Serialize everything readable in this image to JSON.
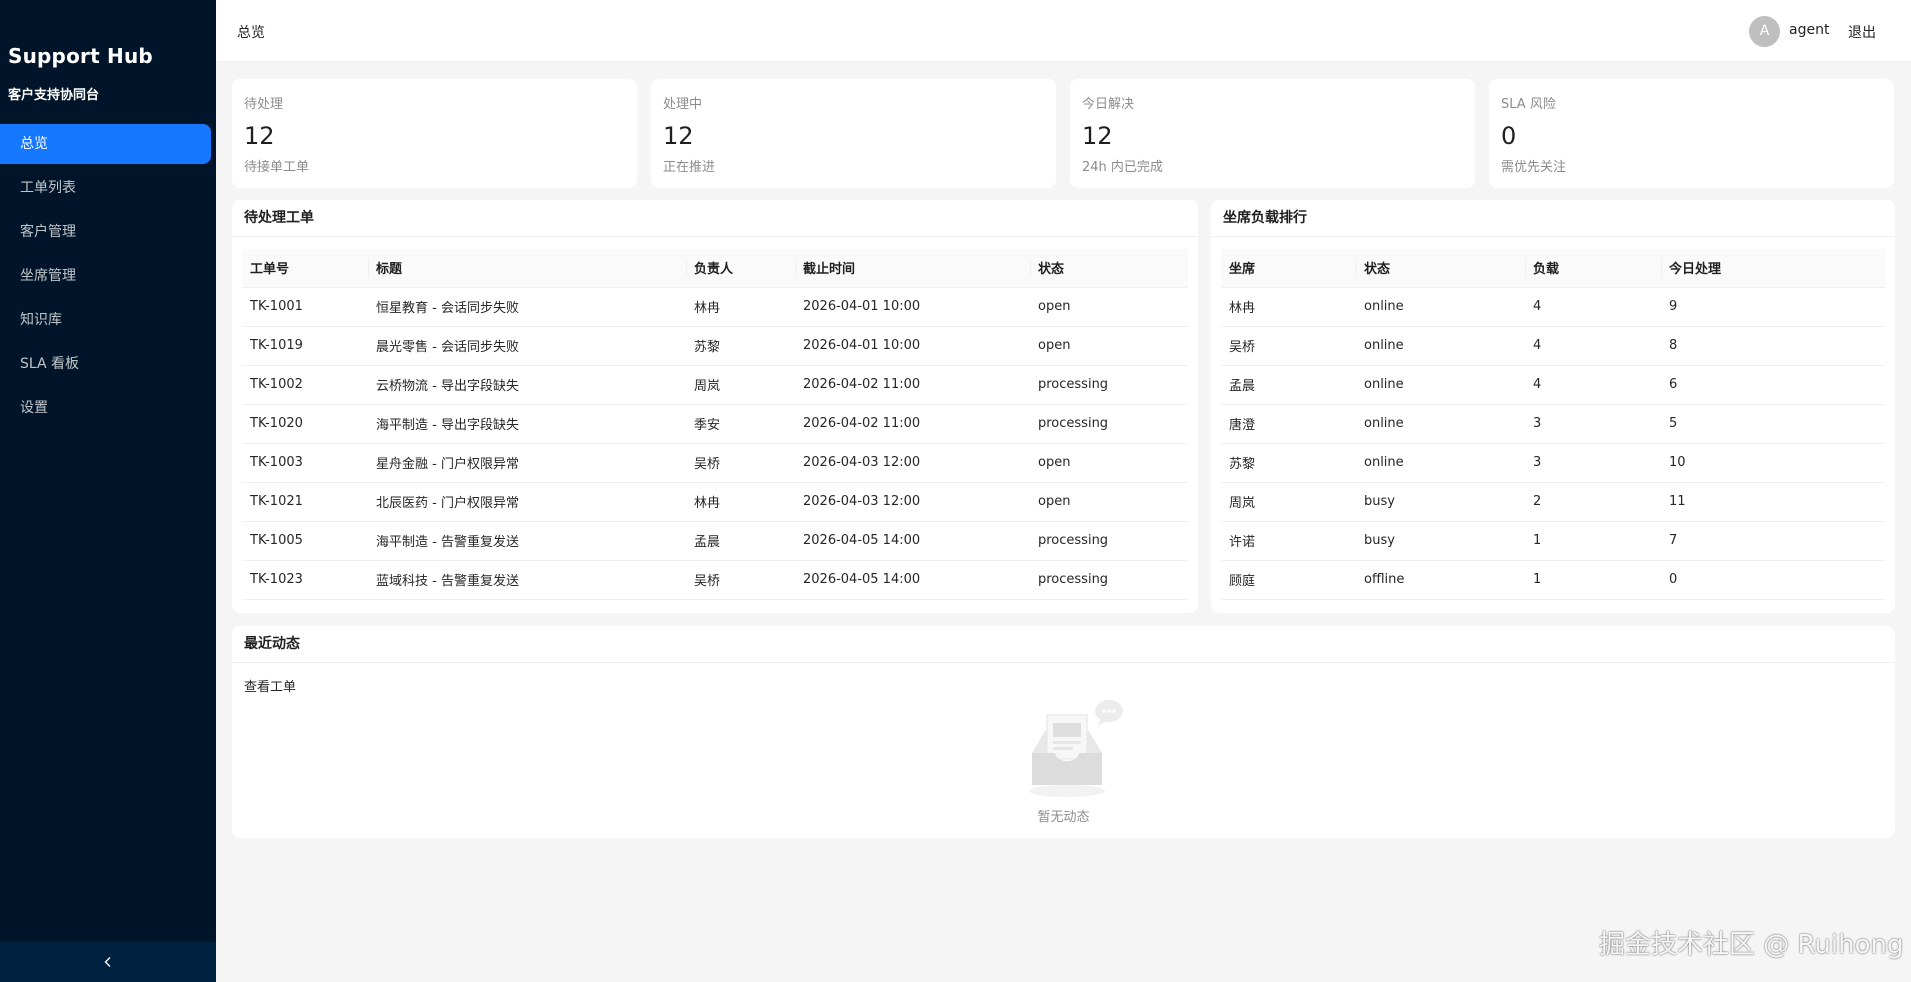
{
  "app": {
    "title": "Support Hub",
    "subtitle": "客户支持协同台"
  },
  "sidebar": {
    "items": [
      {
        "label": "总览",
        "active": true
      },
      {
        "label": "工单列表",
        "active": false
      },
      {
        "label": "客户管理",
        "active": false
      },
      {
        "label": "坐席管理",
        "active": false
      },
      {
        "label": "知识库",
        "active": false
      },
      {
        "label": "SLA 看板",
        "active": false
      },
      {
        "label": "设置",
        "active": false
      }
    ],
    "collapse_icon": "chevron-left-icon"
  },
  "header": {
    "breadcrumb": "总览",
    "avatar_letter": "A",
    "username": "agent",
    "logout_label": "退出"
  },
  "stats": [
    {
      "title": "待处理",
      "value": "12",
      "desc": "待接单工单"
    },
    {
      "title": "处理中",
      "value": "12",
      "desc": "正在推进"
    },
    {
      "title": "今日解决",
      "value": "12",
      "desc": "24h 内已完成"
    },
    {
      "title": "SLA 风险",
      "value": "0",
      "desc": "需优先关注"
    }
  ],
  "pending_tickets": {
    "title": "待处理工单",
    "columns": [
      "工单号",
      "标题",
      "负责人",
      "截止时间",
      "状态"
    ],
    "rows": [
      [
        "TK-1001",
        "恒星教育 - 会话同步失败",
        "林冉",
        "2026-04-01 10:00",
        "open"
      ],
      [
        "TK-1019",
        "晨光零售 - 会话同步失败",
        "苏黎",
        "2026-04-01 10:00",
        "open"
      ],
      [
        "TK-1002",
        "云桥物流 - 导出字段缺失",
        "周岚",
        "2026-04-02 11:00",
        "processing"
      ],
      [
        "TK-1020",
        "海平制造 - 导出字段缺失",
        "季安",
        "2026-04-02 11:00",
        "processing"
      ],
      [
        "TK-1003",
        "星舟金融 - 门户权限异常",
        "吴桥",
        "2026-04-03 12:00",
        "open"
      ],
      [
        "TK-1021",
        "北辰医药 - 门户权限异常",
        "林冉",
        "2026-04-03 12:00",
        "open"
      ],
      [
        "TK-1005",
        "海平制造 - 告警重复发送",
        "孟晨",
        "2026-04-05 14:00",
        "processing"
      ],
      [
        "TK-1023",
        "蓝域科技 - 告警重复发送",
        "吴桥",
        "2026-04-05 14:00",
        "processing"
      ]
    ]
  },
  "agent_load": {
    "title": "坐席负载排行",
    "columns": [
      "坐席",
      "状态",
      "负载",
      "今日处理"
    ],
    "rows": [
      [
        "林冉",
        "online",
        "4",
        "9"
      ],
      [
        "吴桥",
        "online",
        "4",
        "8"
      ],
      [
        "孟晨",
        "online",
        "4",
        "6"
      ],
      [
        "唐澄",
        "online",
        "3",
        "5"
      ],
      [
        "苏黎",
        "online",
        "3",
        "10"
      ],
      [
        "周岚",
        "busy",
        "2",
        "11"
      ],
      [
        "许诺",
        "busy",
        "1",
        "7"
      ],
      [
        "顾庭",
        "offline",
        "1",
        "0"
      ]
    ]
  },
  "activity": {
    "title": "最近动态",
    "link_label": "查看工单",
    "empty_text": "暂无动态",
    "empty_icon": "empty-inbox-icon"
  },
  "watermark": "掘金技术社区 @ Ruihong",
  "colors": {
    "sidebar_bg": "#001529",
    "accent": "#1677ff",
    "page_bg": "#f5f5f5"
  }
}
